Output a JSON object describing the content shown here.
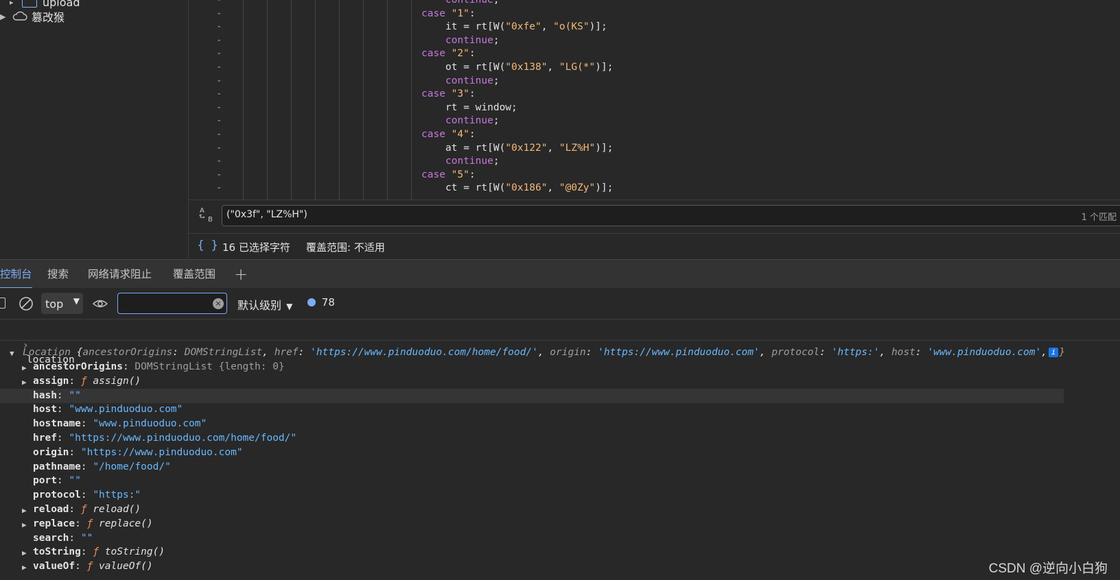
{
  "sidebar": {
    "items": [
      {
        "label": "upload",
        "icon": "folder-icon"
      },
      {
        "label": "篡改猴",
        "icon": "cloud-icon"
      }
    ]
  },
  "editor": {
    "lines": [
      {
        "segments": [
          {
            "t": "kw",
            "v": "continue"
          },
          {
            "t": "ident",
            "v": ";"
          }
        ]
      },
      {
        "segments": [
          {
            "t": "kw",
            "v": "case "
          },
          {
            "t": "str",
            "v": "\"1\""
          },
          {
            "t": "ident",
            "v": ":"
          }
        ]
      },
      {
        "segments": [
          {
            "t": "ident",
            "v": "it = rt[W("
          },
          {
            "t": "str",
            "v": "\"0xfe\""
          },
          {
            "t": "ident",
            "v": ", "
          },
          {
            "t": "str",
            "v": "\"o(KS\""
          },
          {
            "t": "ident",
            "v": ")];"
          }
        ]
      },
      {
        "segments": [
          {
            "t": "kw",
            "v": "continue"
          },
          {
            "t": "ident",
            "v": ";"
          }
        ]
      },
      {
        "segments": [
          {
            "t": "kw",
            "v": "case "
          },
          {
            "t": "str",
            "v": "\"2\""
          },
          {
            "t": "ident",
            "v": ":"
          }
        ]
      },
      {
        "segments": [
          {
            "t": "ident",
            "v": "ot = rt[W("
          },
          {
            "t": "str",
            "v": "\"0x138\""
          },
          {
            "t": "ident",
            "v": ", "
          },
          {
            "t": "str",
            "v": "\"LG(*\""
          },
          {
            "t": "ident",
            "v": ")];"
          }
        ]
      },
      {
        "segments": [
          {
            "t": "kw",
            "v": "continue"
          },
          {
            "t": "ident",
            "v": ";"
          }
        ]
      },
      {
        "segments": [
          {
            "t": "kw",
            "v": "case "
          },
          {
            "t": "str",
            "v": "\"3\""
          },
          {
            "t": "ident",
            "v": ":"
          }
        ]
      },
      {
        "segments": [
          {
            "t": "ident",
            "v": "rt = window;"
          }
        ]
      },
      {
        "segments": [
          {
            "t": "kw",
            "v": "continue"
          },
          {
            "t": "ident",
            "v": ";"
          }
        ]
      },
      {
        "segments": [
          {
            "t": "kw",
            "v": "case "
          },
          {
            "t": "str",
            "v": "\"4\""
          },
          {
            "t": "ident",
            "v": ":"
          }
        ]
      },
      {
        "segments": [
          {
            "t": "ident",
            "v": "at = rt[W("
          },
          {
            "t": "str",
            "v": "\"0x122\""
          },
          {
            "t": "ident",
            "v": ", "
          },
          {
            "t": "str",
            "v": "\"LZ%H\""
          },
          {
            "t": "ident",
            "v": ")];"
          }
        ]
      },
      {
        "segments": [
          {
            "t": "kw",
            "v": "continue"
          },
          {
            "t": "ident",
            "v": ";"
          }
        ]
      },
      {
        "segments": [
          {
            "t": "kw",
            "v": "case "
          },
          {
            "t": "str",
            "v": "\"5\""
          },
          {
            "t": "ident",
            "v": ":"
          }
        ]
      },
      {
        "segments": [
          {
            "t": "ident",
            "v": "ct = rt[W("
          },
          {
            "t": "str",
            "v": "\"0x186\""
          },
          {
            "t": "ident",
            "v": ", "
          },
          {
            "t": "str",
            "v": "\"@0Zy\""
          },
          {
            "t": "ident",
            "v": ")];"
          }
        ]
      }
    ],
    "gutter_mark": "-"
  },
  "search": {
    "case_icon_top": "A",
    "case_icon_bottom": "B",
    "value": "(\"0x3f\", \"LZ%H\")",
    "result_count": "1 个匹配"
  },
  "status": {
    "braces": "{ }",
    "selected": "16 已选择字符",
    "coverage": "覆盖范围: 不适用"
  },
  "drawer": {
    "tabs": [
      "控制台",
      "搜索",
      "网络请求阻止",
      "覆盖范围"
    ],
    "add_tab": "+"
  },
  "toolbar": {
    "context": "top",
    "filter_placeholder": "",
    "level": "默认级别",
    "message_count": "78"
  },
  "console": {
    "input": "location",
    "object_summary": {
      "class": "Location",
      "parts": [
        {
          "k": "ancestorOrigins",
          "v": "DOMStringList",
          "type": "muted"
        },
        {
          "k": "href",
          "v": "'https://www.pinduoduo.com/home/food/'",
          "type": "str"
        },
        {
          "k": "origin",
          "v": "'https://www.pinduoduo.com'",
          "type": "str"
        },
        {
          "k": "protocol",
          "v": "'https:'",
          "type": "str"
        },
        {
          "k": "host",
          "v": "'www.pinduoduo.com'",
          "type": "str"
        }
      ],
      "ellipsis": "…}"
    },
    "props": [
      {
        "key": "ancestorOrigins",
        "value": "DOMStringList {length: 0}",
        "kind": "obj",
        "expandable": true
      },
      {
        "key": "assign",
        "value": "assign()",
        "kind": "fn",
        "expandable": true
      },
      {
        "key": "hash",
        "value": "\"\"",
        "kind": "str",
        "expandable": false,
        "highlight": true
      },
      {
        "key": "host",
        "value": "\"www.pinduoduo.com\"",
        "kind": "str",
        "expandable": false
      },
      {
        "key": "hostname",
        "value": "\"www.pinduoduo.com\"",
        "kind": "str",
        "expandable": false
      },
      {
        "key": "href",
        "value": "\"https://www.pinduoduo.com/home/food/\"",
        "kind": "str",
        "expandable": false
      },
      {
        "key": "origin",
        "value": "\"https://www.pinduoduo.com\"",
        "kind": "str",
        "expandable": false
      },
      {
        "key": "pathname",
        "value": "\"/home/food/\"",
        "kind": "str",
        "expandable": false
      },
      {
        "key": "port",
        "value": "\"\"",
        "kind": "str",
        "expandable": false
      },
      {
        "key": "protocol",
        "value": "\"https:\"",
        "kind": "str",
        "expandable": false
      },
      {
        "key": "reload",
        "value": "reload()",
        "kind": "fn",
        "expandable": true
      },
      {
        "key": "replace",
        "value": "replace()",
        "kind": "fn",
        "expandable": true
      },
      {
        "key": "search",
        "value": "\"\"",
        "kind": "str",
        "expandable": false
      },
      {
        "key": "toString",
        "value": "toString()",
        "kind": "fn",
        "expandable": true
      },
      {
        "key": "valueOf",
        "value": "valueOf()",
        "kind": "fn",
        "expandable": true
      }
    ]
  },
  "watermark": "CSDN @逆向小白狗",
  "colors": {
    "accent": "#7cacf8",
    "string": "#69b8ff",
    "keyword": "#c678dd",
    "code_string": "#f5b979"
  }
}
